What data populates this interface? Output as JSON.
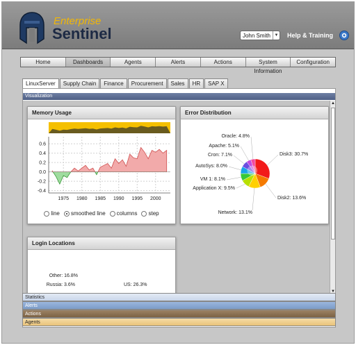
{
  "brand": {
    "top": "Enterprise",
    "main": "Sentinel"
  },
  "header": {
    "user": "John Smith",
    "help": "Help & Training",
    "icons": {
      "logo": "spartan-helmet-icon",
      "settings": "gear-icon",
      "user_menu": "chevron-down-icon"
    }
  },
  "nav": [
    {
      "label": "Home",
      "active": false
    },
    {
      "label": "Dashboards",
      "active": true
    },
    {
      "label": "Agents",
      "active": false
    },
    {
      "label": "Alerts",
      "active": false
    },
    {
      "label": "Actions",
      "active": false
    },
    {
      "label": "System Information",
      "active": false
    },
    {
      "label": "Configuration",
      "active": false
    }
  ],
  "subtabs": [
    {
      "label": "LinuxServer",
      "active": true
    },
    {
      "label": "Supply Chain",
      "active": false
    },
    {
      "label": "Finance",
      "active": false
    },
    {
      "label": "Procurement",
      "active": false
    },
    {
      "label": "Sales",
      "active": false
    },
    {
      "label": "HR",
      "active": false
    },
    {
      "label": "SAP X",
      "active": false
    }
  ],
  "visualization": {
    "title": "Visualization"
  },
  "memory": {
    "title": "Memory Usage",
    "options": [
      {
        "label": "line",
        "selected": false
      },
      {
        "label": "smoothed line",
        "selected": true
      },
      {
        "label": "columns",
        "selected": false
      },
      {
        "label": "step",
        "selected": false
      }
    ]
  },
  "error_dist": {
    "title": "Error Distribution"
  },
  "login": {
    "title": "Login Locations"
  },
  "accordion": {
    "statistics": "Statistics",
    "alerts": "Alerts",
    "actions": "Actions",
    "agents": "Agents"
  },
  "chart_data": [
    {
      "type": "area",
      "title": "Memory Usage",
      "x_ticks": [
        "1975",
        "1980",
        "1985",
        "1990",
        "1995",
        "2000"
      ],
      "y_ticks": [
        "0.6",
        "0.4",
        "0.2",
        "0.0",
        "-0.2",
        "-0.4"
      ],
      "ylim": [
        -0.45,
        0.75
      ],
      "xlim": [
        1971,
        2004
      ],
      "grid": true,
      "positive_color": "#f2aaaa",
      "negative_color": "#9fdc9f",
      "overview_color": "#f5c000",
      "x": [
        1972,
        1973,
        1974,
        1975,
        1976,
        1977,
        1978,
        1979,
        1980,
        1981,
        1982,
        1983,
        1984,
        1985,
        1986,
        1987,
        1988,
        1989,
        1990,
        1991,
        1992,
        1993,
        1994,
        1995,
        1996,
        1997,
        1998,
        1999,
        2000,
        2001,
        2002,
        2003
      ],
      "y": [
        0.02,
        -0.1,
        -0.26,
        -0.08,
        -0.12,
        0.0,
        0.08,
        0.02,
        0.08,
        0.14,
        0.04,
        0.08,
        -0.06,
        0.1,
        0.14,
        0.18,
        0.08,
        0.28,
        0.18,
        0.26,
        0.12,
        0.38,
        0.3,
        0.28,
        0.52,
        0.42,
        0.28,
        0.46,
        0.42,
        0.48,
        0.4,
        0.46
      ]
    },
    {
      "type": "pie",
      "title": "Error Distribution",
      "categories": [
        "Disk3",
        "Disk2",
        "Network",
        "Application X",
        "VM 1",
        "AutoSys",
        "Cron",
        "Apache",
        "Oracle"
      ],
      "labels": [
        "Disk3: 30.7%",
        "Disk2: 13.6%",
        "Network: 13.1%",
        "Application X: 9.5%",
        "VM 1: 8.1%",
        "AutoSys: 8.0%",
        "Cron: 7.1%",
        "Apache: 5.1%",
        "Oracle: 4.8%"
      ],
      "values": [
        30.7,
        13.6,
        13.1,
        9.5,
        8.1,
        8.0,
        7.1,
        5.1,
        4.8
      ],
      "colors": [
        "#f21a1a",
        "#f57a00",
        "#ffd000",
        "#b8e000",
        "#37c837",
        "#1aa3e8",
        "#6c4de0",
        "#c24ae0",
        "#f24aa0"
      ]
    },
    {
      "type": "pie",
      "title": "Login Locations",
      "categories": [
        "US",
        "Russia",
        "Other"
      ],
      "labels": [
        "US: 26.3%",
        "Russia: 3.6%",
        "Other: 16.8%"
      ],
      "values": [
        26.3,
        3.6,
        16.8
      ],
      "colors": [
        "#f21a1a",
        "#c24ae0",
        "#6c4de0"
      ]
    }
  ]
}
